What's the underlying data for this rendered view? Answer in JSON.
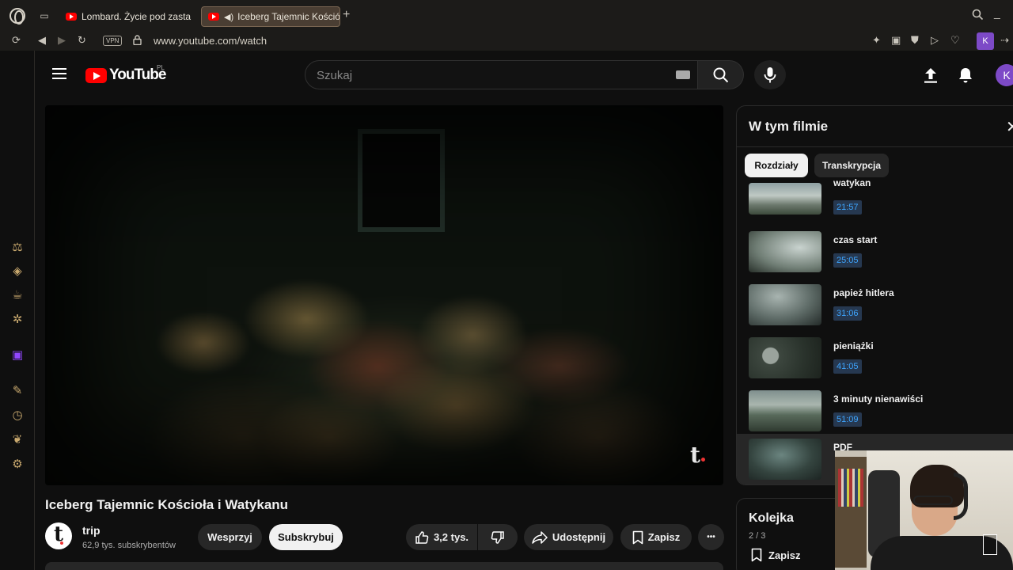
{
  "browser": {
    "tabs": [
      {
        "label": "Lombard. Życie pod zasta"
      },
      {
        "label": "Iceberg Tajemnic Kośció"
      }
    ],
    "vpn_label": "VPN",
    "url": "www.youtube.com/watch",
    "profile_initial": "K"
  },
  "youtube": {
    "logo_text": "YouTube",
    "country_code": "PL",
    "search_placeholder": "Szukaj",
    "avatar_initial": "K"
  },
  "video": {
    "title": "Iceberg Tajemnic Kościoła i Watykanu",
    "watermark": "t",
    "channel": {
      "avatar_letter": "t",
      "name": "trip",
      "subscribers": "62,9 tys. subskrybentów"
    },
    "actions": {
      "support": "Wesprzyj",
      "subscribe": "Subskrybuj",
      "likes": "3,2 tys.",
      "share": "Udostępnij",
      "save": "Zapisz",
      "more": "•••"
    }
  },
  "chapters_panel": {
    "title": "W tym filmie",
    "tabs": [
      "Rozdziały",
      "Transkrypcja"
    ],
    "items": [
      {
        "title": "watykan",
        "time": "21:57"
      },
      {
        "title": "czas start",
        "time": "25:05"
      },
      {
        "title": "papież hitlera",
        "time": "31:06"
      },
      {
        "title": "pieniążki",
        "time": "41:05"
      },
      {
        "title": "3 minuty nienawiści",
        "time": "51:09"
      },
      {
        "title": "PDF",
        "time": ""
      }
    ]
  },
  "queue": {
    "title": "Kolejka",
    "count": "2 / 3",
    "save_label": "Zapisz"
  },
  "colors": {
    "accent": "#ff0000",
    "timestamp": "#3ea6ff",
    "profile": "#7d4ac7"
  }
}
